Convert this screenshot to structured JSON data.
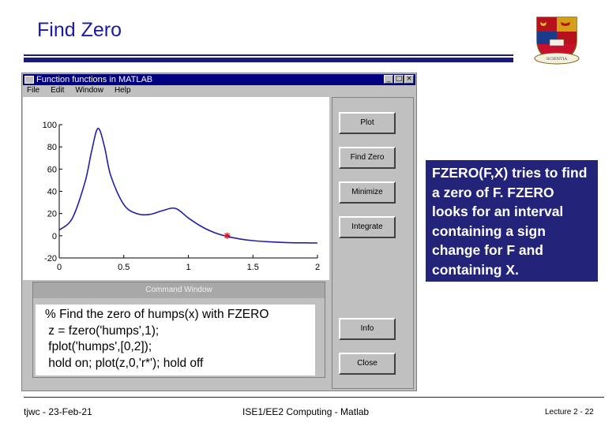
{
  "slide": {
    "title": "Find Zero"
  },
  "window": {
    "title": "Function functions in MATLAB",
    "controls": [
      "_",
      "□",
      "×"
    ],
    "menu": [
      "File",
      "Edit",
      "Window",
      "Help"
    ]
  },
  "plot": {
    "y_ticks": [
      "100",
      "80",
      "60",
      "40",
      "20",
      "0",
      "-20"
    ],
    "x_ticks": [
      "0",
      "0.5",
      "1",
      "1.5",
      "2"
    ],
    "line_color": "#1f1fa8",
    "marker_color": "#e01010"
  },
  "chart_data": {
    "type": "line",
    "series": [
      {
        "x": [
          0,
          0.1,
          0.2,
          0.25,
          0.3,
          0.35,
          0.4,
          0.5,
          0.6,
          0.7,
          0.8,
          0.9,
          1.0,
          1.1,
          1.2,
          1.3,
          1.4,
          1.5,
          1.6,
          1.7,
          1.8,
          1.9,
          2.0
        ],
        "y": [
          5.2,
          15.5,
          48.4,
          75.8,
          96.6,
          80.5,
          53.6,
          28.1,
          19.9,
          19.2,
          22.6,
          24.6,
          16.0,
          8.4,
          2.9,
          -0.6,
          -2.9,
          -4.4,
          -5.3,
          -5.9,
          -6.3,
          -6.4,
          -6.5
        ]
      },
      {
        "x": [
          1.3
        ],
        "y": [
          0
        ]
      }
    ],
    "xlim": [
      0,
      2
    ],
    "ylim": [
      -20,
      100
    ],
    "grid": false,
    "title": "",
    "xlabel": "",
    "ylabel": ""
  },
  "command_window": {
    "header": "Command Window",
    "lines": [
      "% Find the zero of humps(x) with FZERO",
      " z = fzero('humps',1);",
      " fplot('humps',[0,2]);",
      " hold on; plot(z,0,'r*'); hold off"
    ]
  },
  "buttons": {
    "plot": "Plot",
    "find_zero": "Find Zero",
    "minimize": "Minimize",
    "integrate": "Integrate",
    "info": "Info",
    "close": "Close"
  },
  "callout": {
    "text": "FZERO(F,X) tries to find a zero of F. FZERO looks for an interval containing a sign change for F and containing X."
  },
  "footer": {
    "left": "tjwc - 23-Feb-21",
    "center": "ISE1/EE2 Computing - Matlab",
    "right": "Lecture 2 - 22"
  },
  "colors": {
    "title_text": "#1a1aa6",
    "callout_bg": "#23237a",
    "titlebar_bg": "#000080",
    "window_gray": "#c0c0c0"
  },
  "icons": [
    "college-crest-icon",
    "window-app-icon"
  ]
}
